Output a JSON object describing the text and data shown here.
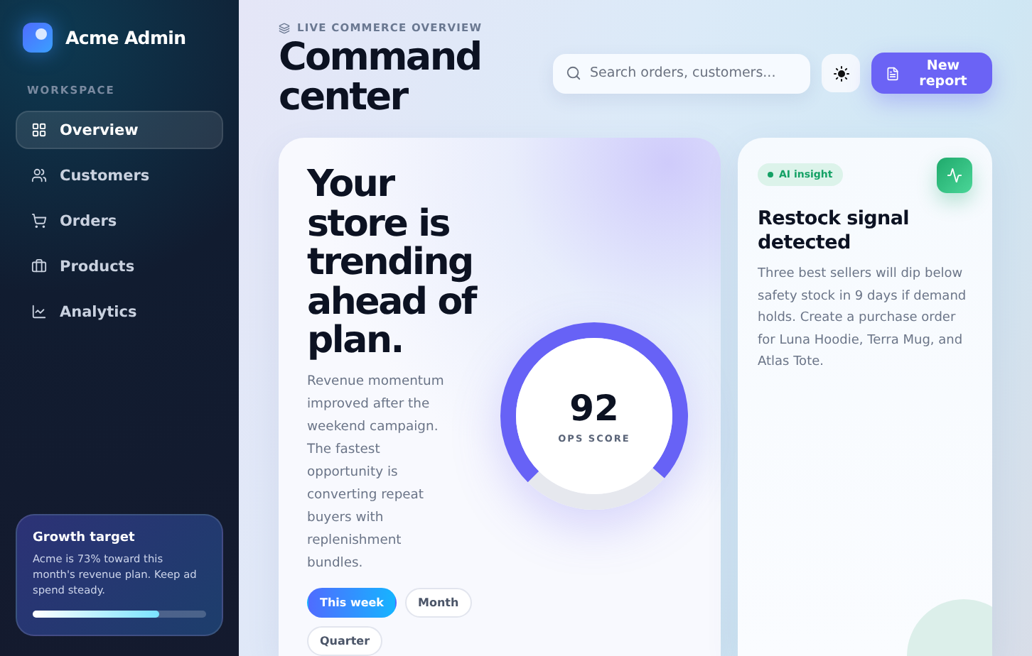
{
  "sidebar": {
    "brand": "Acme Admin",
    "section_label": "WORKSPACE",
    "items": [
      {
        "label": "Overview",
        "selected": true
      },
      {
        "label": "Customers",
        "selected": false
      },
      {
        "label": "Orders",
        "selected": false
      },
      {
        "label": "Products",
        "selected": false
      },
      {
        "label": "Analytics",
        "selected": false
      }
    ],
    "promo": {
      "title": "Growth target",
      "text": "Acme is 73% toward this month's revenue plan. Keep ad spend steady.",
      "level": 0.73
    }
  },
  "header": {
    "eyebrow": "LIVE COMMERCE OVERVIEW",
    "title": "Command center",
    "search": {
      "placeholder": "Search orders, customers..."
    },
    "primary_button": "New report"
  },
  "hero": {
    "headline": "Your store is trending ahead of plan.",
    "body": "Revenue momentum improved after the weekend campaign. The fastest opportunity is converting repeat buyers with replenishment bundles.",
    "periods": [
      {
        "label": "This week",
        "selected": true
      },
      {
        "label": "Month",
        "selected": false
      },
      {
        "label": "Quarter",
        "selected": false
      }
    ],
    "gauge": {
      "value": "92",
      "label": "OPS SCORE",
      "level": 0.74
    }
  },
  "insight": {
    "badge": "AI insight",
    "title": "Restock signal detected",
    "text": "Three best sellers will dip below safety stock in 9 days if demand holds. Create a purchase order for Luna Hoodie, Terra Mug, and Atlas Tote."
  }
}
